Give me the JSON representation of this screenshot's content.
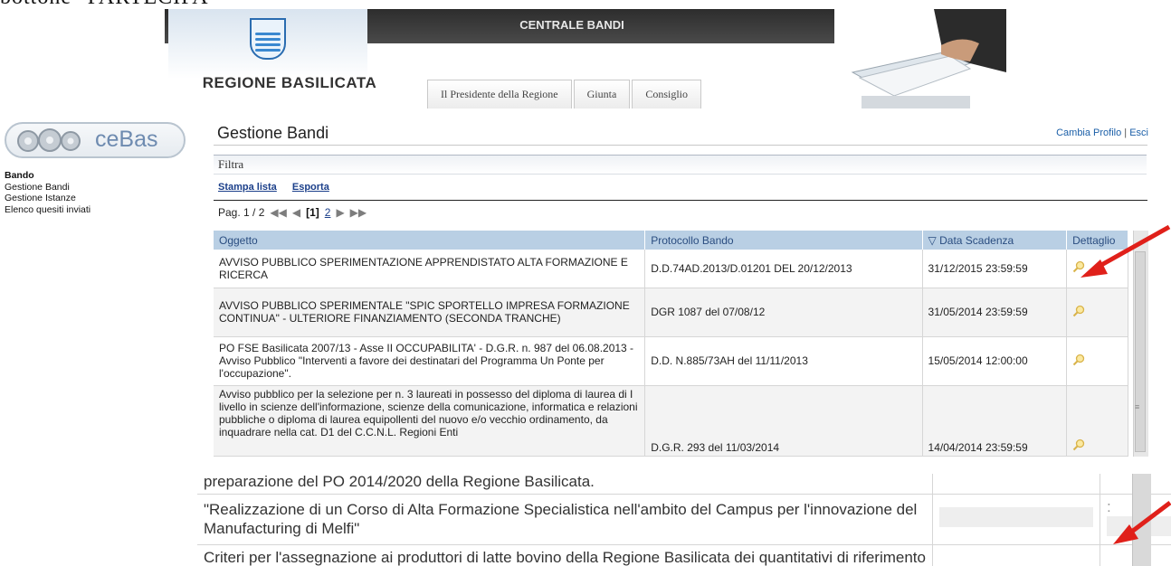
{
  "top_cut_text": "bottone \"PARTECIPA\"",
  "header": {
    "title": "CENTRALE BANDI",
    "region": "REGIONE BASILICATA",
    "tabs": [
      "Il Presidente della Regione",
      "Giunta",
      "Consiglio"
    ]
  },
  "sidebar": {
    "logo_text": "ceBas",
    "items": [
      "Bando",
      "Gestione Bandi",
      "Gestione Istanze",
      "Elenco quesiti inviati"
    ]
  },
  "main": {
    "title": "Gestione Bandi",
    "links": {
      "change_profile": "Cambia Profilo",
      "separator": "|",
      "exit": "Esci"
    },
    "filter_label": "Filtra",
    "actions": {
      "print": "Stampa lista",
      "export": "Esporta"
    },
    "pager": {
      "label": "Pag. 1 / 2",
      "current": "[1]",
      "next": "2"
    },
    "table": {
      "headers": [
        "Oggetto",
        "Protocollo Bando",
        "Data Scadenza",
        "Dettaglio"
      ],
      "rows": [
        {
          "oggetto": "AVVISO PUBBLICO SPERIMENTAZIONE APPRENDISTATO ALTA FORMAZIONE E RICERCA",
          "protocollo": "D.D.74AD.2013/D.01201 DEL 20/12/2013",
          "scadenza": "31/12/2015 23:59:59"
        },
        {
          "oggetto": "AVVISO PUBBLICO SPERIMENTALE \"SPIC SPORTELLO IMPRESA FORMAZIONE CONTINUA\" - ULTERIORE FINANZIAMENTO (SECONDA TRANCHE)",
          "protocollo": "DGR 1087 del 07/08/12",
          "scadenza": "31/05/2014 23:59:59"
        },
        {
          "oggetto": "PO FSE Basilicata 2007/13 - Asse II OCCUPABILITA' - D.G.R. n. 987 del 06.08.2013 - Avviso Pubblico \"Interventi a favore dei destinatari del Programma Un Ponte per l'occupazione\".",
          "protocollo": "D.D. N.885/73AH del 11/11/2013",
          "scadenza": "15/05/2014 12:00:00"
        },
        {
          "oggetto": "Avviso pubblico per la selezione per n. 3 laureati in possesso del diploma di laurea di I livello in scienze dell'informazione, scienze della comunicazione, informatica e relazioni pubbliche o diploma di laurea equipollenti del nuovo e/o vecchio ordinamento, da inquadrare nella cat. D1 del C.C.N.L. Regioni Enti",
          "protocollo": "D.G.R. 293 del 11/03/2014",
          "scadenza": "14/04/2014 23:59:59"
        }
      ]
    }
  },
  "bottom": {
    "rows": [
      {
        "oggetto": "preparazione del PO 2014/2020 della Regione Basilicata."
      },
      {
        "oggetto": "\"Realizzazione di un Corso di Alta Formazione Specialistica nell'ambito del Campus per l'innovazione del Manufacturing di Melfi\"",
        "mark": ":"
      },
      {
        "oggetto": "Criteri per l'assegnazione ai produttori di latte bovino della Regione Basilicata dei quantitativi di riferimento"
      }
    ]
  },
  "colors": {
    "header_bg": "#b9cfe4",
    "link": "#1b5fa8",
    "arrow": "#e0201a"
  }
}
